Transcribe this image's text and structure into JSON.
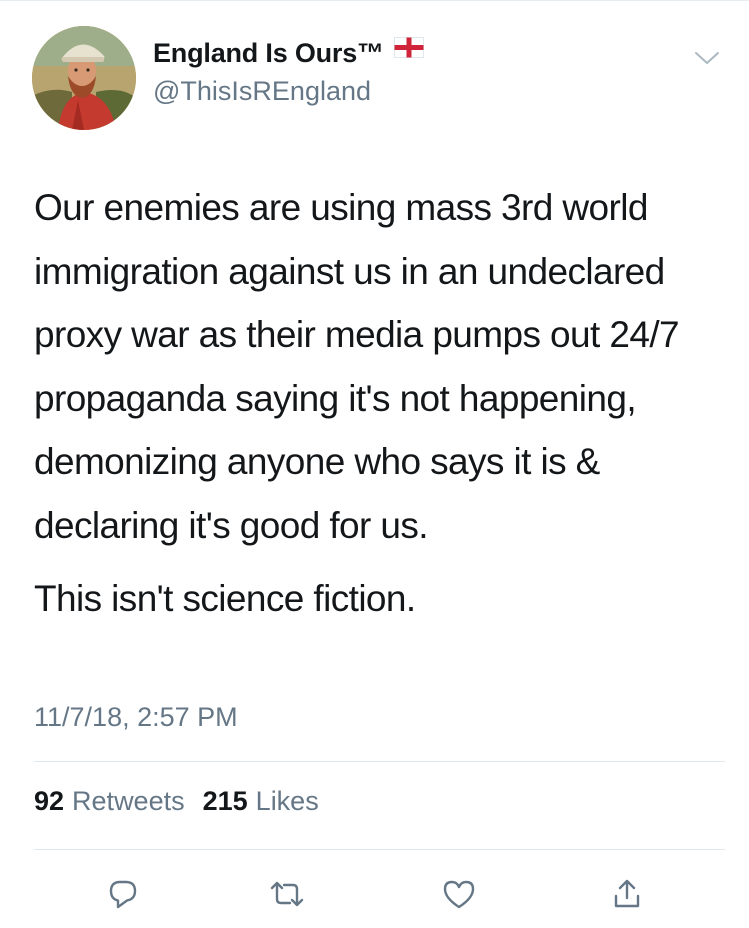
{
  "tweet": {
    "display_name": "England Is Ours™",
    "handle": "@ThisIsREngland",
    "flag_icon": "england-flag-icon",
    "menu_icon": "chevron-down-icon",
    "text_paragraph_1": "Our enemies are using mass 3rd world immigration against us in an undeclared proxy war as their media pumps out 24/7 propaganda saying it's not happening, demonizing anyone who says it is & declaring it's good for us.",
    "text_paragraph_2": "This isn't science fiction.",
    "timestamp": "11/7/18, 2:57 PM",
    "retweets_count": "92",
    "retweets_label": "Retweets",
    "likes_count": "215",
    "likes_label": "Likes"
  },
  "actions": {
    "reply_icon": "reply-icon",
    "retweet_icon": "retweet-icon",
    "like_icon": "heart-icon",
    "share_icon": "share-icon"
  },
  "colors": {
    "text_primary": "#14171a",
    "text_secondary": "#657786",
    "divider": "#e1e8ed",
    "flag_red": "#d0243b"
  }
}
